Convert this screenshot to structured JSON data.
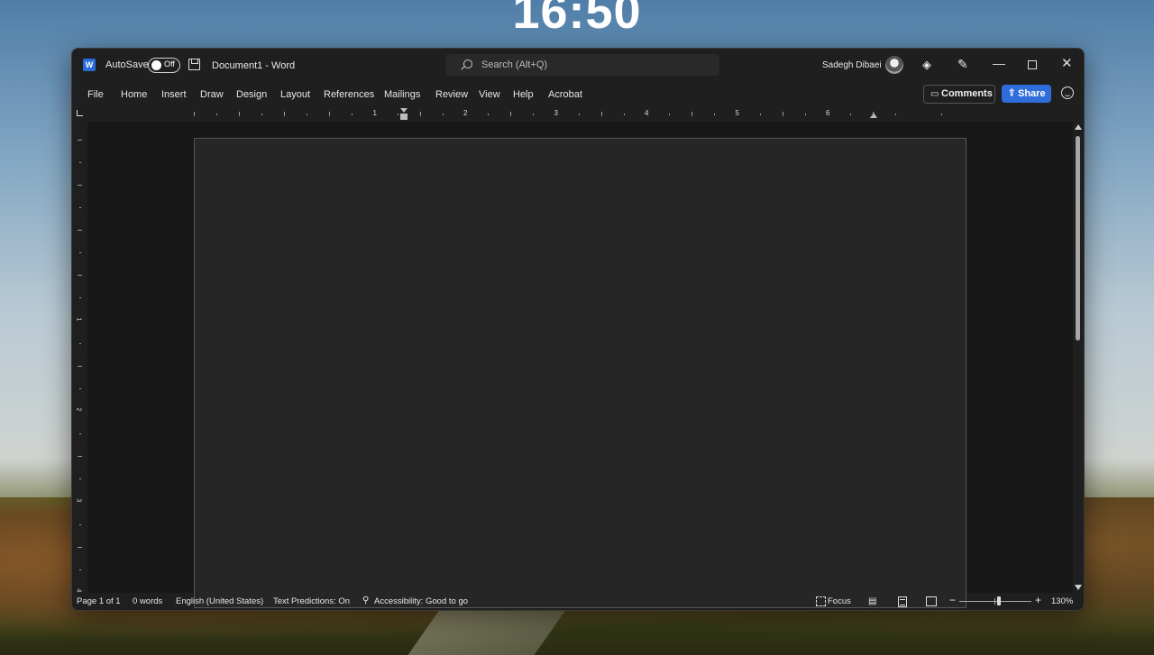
{
  "desktop": {
    "clock": "16:50"
  },
  "titlebar": {
    "app_icon": "word-icon",
    "app_icon_letter": "W",
    "autosave_label": "AutoSave",
    "autosave_state": "Off",
    "document_title": "Document1  -  Word",
    "search_placeholder": "Search (Alt+Q)",
    "user_name": "Sadegh Dibaei",
    "icons": [
      "save-icon",
      "search-icon",
      "diamond-icon",
      "pen-icon",
      "minimize-icon",
      "maximize-icon",
      "close-icon"
    ],
    "minimize_glyph": "—",
    "close_glyph": "✕",
    "diamond_glyph": "◈",
    "pen_glyph": "✎"
  },
  "menubar": {
    "items": [
      "File",
      "Home",
      "Insert",
      "Draw",
      "Design",
      "Layout",
      "References",
      "Mailings",
      "Review",
      "View",
      "Help",
      "Acrobat"
    ],
    "comments_label": "Comments",
    "share_label": "Share",
    "comments_glyph": "▭",
    "share_glyph": "⇪",
    "share_color": "#2f6ddb"
  },
  "ruler": {
    "horizontal_numbers": [
      "1",
      "2",
      "3",
      "4",
      "5",
      "6"
    ],
    "vertical_numbers": [
      "1",
      "2",
      "3",
      "4"
    ]
  },
  "statusbar": {
    "page": "Page 1 of 1",
    "words": "0 words",
    "language": "English (United States)",
    "text_predictions": "Text Predictions: On",
    "accessibility": "Accessibility: Good to go",
    "accessibility_glyph": "⚲",
    "focus_label": "Focus",
    "read_glyph": "▤",
    "zoom_minus": "−",
    "zoom_plus": "+",
    "zoom_level": "130%"
  },
  "theme": {
    "window_bg": "#1f1f1f",
    "page_bg": "#262626",
    "accent": "#2f6ddb",
    "word_blue": "#2b6bd8"
  }
}
